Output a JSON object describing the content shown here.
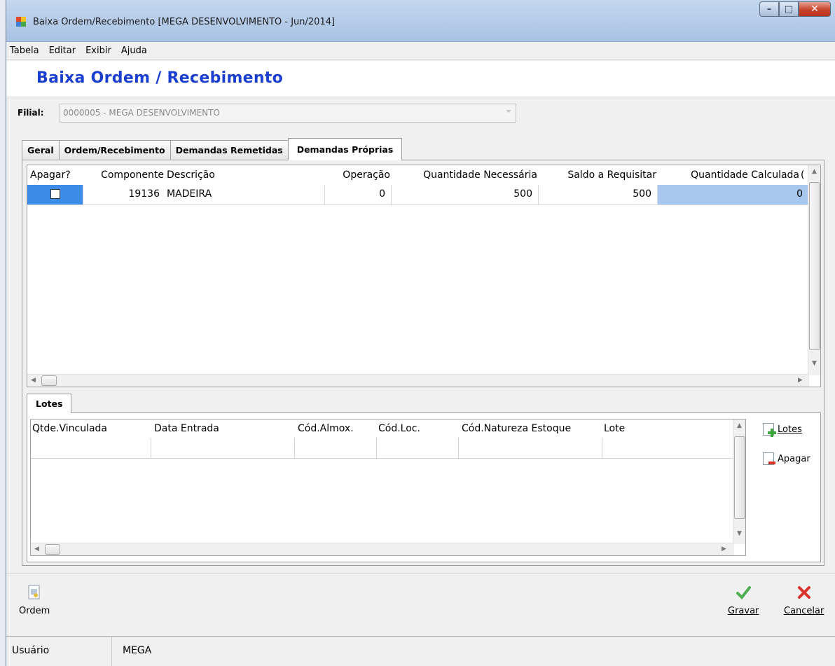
{
  "window": {
    "title": "Baixa Ordem/Recebimento [MEGA DESENVOLVIMENTO - Jun/2014]",
    "minimize": "–",
    "maximize": "□",
    "close": "✕"
  },
  "menu": [
    "Tabela",
    "Editar",
    "Exibir",
    "Ajuda"
  ],
  "page_title": "Baixa Ordem / Recebimento",
  "filial": {
    "label": "Filial:",
    "value": "0000005 - MEGA DESENVOLVIMENTO"
  },
  "tabs": [
    "Geral",
    "Ordem/Recebimento",
    "Demandas Remetidas",
    "Demandas Próprias"
  ],
  "grid": {
    "columns": [
      "Apagar?",
      "Componente",
      "Descrição",
      "Operação",
      "Quantidade Necessária",
      "Saldo a Requisitar",
      "Quantidade Calculada",
      "("
    ],
    "rows": [
      {
        "apagar": "",
        "componente": "19136",
        "descricao": "MADEIRA",
        "operacao": "0",
        "quantidade_necessaria": "500",
        "saldo_requisitar": "500",
        "quantidade_calculada": "0"
      }
    ]
  },
  "lotes": {
    "tab_label": "Lotes",
    "columns": [
      "Qtde.Vinculada",
      "Data Entrada",
      "Cód.Almox.",
      "Cód.Loc.",
      "Cód.Natureza Estoque",
      "Lote"
    ],
    "buttons": {
      "add": "Lotes",
      "delete": "Apagar"
    }
  },
  "toolbar": {
    "ordem": "Ordem",
    "gravar": "Gravar",
    "cancelar": "Cancelar"
  },
  "status": {
    "label": "Usuário",
    "user": "MEGA"
  },
  "colors": {
    "title_blue": "#1a3fd0",
    "selection_blue": "#3d8ce8",
    "calc_cell": "#a7c7ef",
    "check_green": "#4caf50",
    "cancel_red": "#d9342b"
  },
  "icons": [
    "app-icon",
    "document-icon",
    "check-icon",
    "x-icon",
    "add-lote-icon",
    "delete-lote-icon"
  ]
}
